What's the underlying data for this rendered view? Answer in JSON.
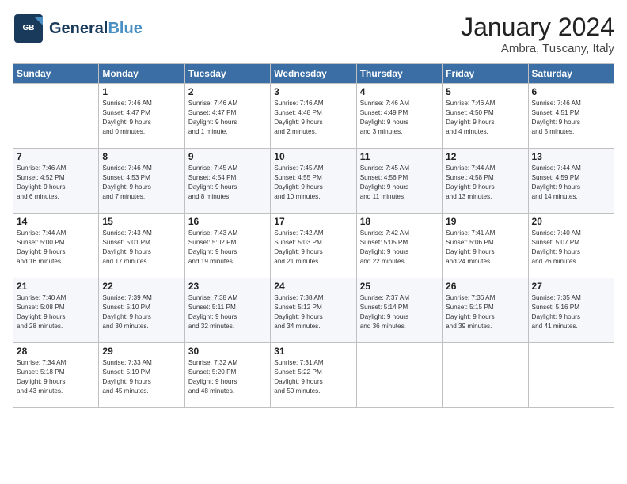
{
  "header": {
    "logo_line1": "General",
    "logo_line2": "Blue",
    "title": "January 2024",
    "subtitle": "Ambra, Tuscany, Italy"
  },
  "columns": [
    "Sunday",
    "Monday",
    "Tuesday",
    "Wednesday",
    "Thursday",
    "Friday",
    "Saturday"
  ],
  "weeks": [
    [
      {
        "day": "",
        "sunrise": "",
        "sunset": "",
        "daylight": ""
      },
      {
        "day": "1",
        "sunrise": "Sunrise: 7:46 AM",
        "sunset": "Sunset: 4:47 PM",
        "daylight": "Daylight: 9 hours and 0 minutes."
      },
      {
        "day": "2",
        "sunrise": "Sunrise: 7:46 AM",
        "sunset": "Sunset: 4:47 PM",
        "daylight": "Daylight: 9 hours and 1 minute."
      },
      {
        "day": "3",
        "sunrise": "Sunrise: 7:46 AM",
        "sunset": "Sunset: 4:48 PM",
        "daylight": "Daylight: 9 hours and 2 minutes."
      },
      {
        "day": "4",
        "sunrise": "Sunrise: 7:46 AM",
        "sunset": "Sunset: 4:49 PM",
        "daylight": "Daylight: 9 hours and 3 minutes."
      },
      {
        "day": "5",
        "sunrise": "Sunrise: 7:46 AM",
        "sunset": "Sunset: 4:50 PM",
        "daylight": "Daylight: 9 hours and 4 minutes."
      },
      {
        "day": "6",
        "sunrise": "Sunrise: 7:46 AM",
        "sunset": "Sunset: 4:51 PM",
        "daylight": "Daylight: 9 hours and 5 minutes."
      }
    ],
    [
      {
        "day": "7",
        "sunrise": "Sunrise: 7:46 AM",
        "sunset": "Sunset: 4:52 PM",
        "daylight": "Daylight: 9 hours and 6 minutes."
      },
      {
        "day": "8",
        "sunrise": "Sunrise: 7:46 AM",
        "sunset": "Sunset: 4:53 PM",
        "daylight": "Daylight: 9 hours and 7 minutes."
      },
      {
        "day": "9",
        "sunrise": "Sunrise: 7:45 AM",
        "sunset": "Sunset: 4:54 PM",
        "daylight": "Daylight: 9 hours and 8 minutes."
      },
      {
        "day": "10",
        "sunrise": "Sunrise: 7:45 AM",
        "sunset": "Sunset: 4:55 PM",
        "daylight": "Daylight: 9 hours and 10 minutes."
      },
      {
        "day": "11",
        "sunrise": "Sunrise: 7:45 AM",
        "sunset": "Sunset: 4:56 PM",
        "daylight": "Daylight: 9 hours and 11 minutes."
      },
      {
        "day": "12",
        "sunrise": "Sunrise: 7:44 AM",
        "sunset": "Sunset: 4:58 PM",
        "daylight": "Daylight: 9 hours and 13 minutes."
      },
      {
        "day": "13",
        "sunrise": "Sunrise: 7:44 AM",
        "sunset": "Sunset: 4:59 PM",
        "daylight": "Daylight: 9 hours and 14 minutes."
      }
    ],
    [
      {
        "day": "14",
        "sunrise": "Sunrise: 7:44 AM",
        "sunset": "Sunset: 5:00 PM",
        "daylight": "Daylight: 9 hours and 16 minutes."
      },
      {
        "day": "15",
        "sunrise": "Sunrise: 7:43 AM",
        "sunset": "Sunset: 5:01 PM",
        "daylight": "Daylight: 9 hours and 17 minutes."
      },
      {
        "day": "16",
        "sunrise": "Sunrise: 7:43 AM",
        "sunset": "Sunset: 5:02 PM",
        "daylight": "Daylight: 9 hours and 19 minutes."
      },
      {
        "day": "17",
        "sunrise": "Sunrise: 7:42 AM",
        "sunset": "Sunset: 5:03 PM",
        "daylight": "Daylight: 9 hours and 21 minutes."
      },
      {
        "day": "18",
        "sunrise": "Sunrise: 7:42 AM",
        "sunset": "Sunset: 5:05 PM",
        "daylight": "Daylight: 9 hours and 22 minutes."
      },
      {
        "day": "19",
        "sunrise": "Sunrise: 7:41 AM",
        "sunset": "Sunset: 5:06 PM",
        "daylight": "Daylight: 9 hours and 24 minutes."
      },
      {
        "day": "20",
        "sunrise": "Sunrise: 7:40 AM",
        "sunset": "Sunset: 5:07 PM",
        "daylight": "Daylight: 9 hours and 26 minutes."
      }
    ],
    [
      {
        "day": "21",
        "sunrise": "Sunrise: 7:40 AM",
        "sunset": "Sunset: 5:08 PM",
        "daylight": "Daylight: 9 hours and 28 minutes."
      },
      {
        "day": "22",
        "sunrise": "Sunrise: 7:39 AM",
        "sunset": "Sunset: 5:10 PM",
        "daylight": "Daylight: 9 hours and 30 minutes."
      },
      {
        "day": "23",
        "sunrise": "Sunrise: 7:38 AM",
        "sunset": "Sunset: 5:11 PM",
        "daylight": "Daylight: 9 hours and 32 minutes."
      },
      {
        "day": "24",
        "sunrise": "Sunrise: 7:38 AM",
        "sunset": "Sunset: 5:12 PM",
        "daylight": "Daylight: 9 hours and 34 minutes."
      },
      {
        "day": "25",
        "sunrise": "Sunrise: 7:37 AM",
        "sunset": "Sunset: 5:14 PM",
        "daylight": "Daylight: 9 hours and 36 minutes."
      },
      {
        "day": "26",
        "sunrise": "Sunrise: 7:36 AM",
        "sunset": "Sunset: 5:15 PM",
        "daylight": "Daylight: 9 hours and 39 minutes."
      },
      {
        "day": "27",
        "sunrise": "Sunrise: 7:35 AM",
        "sunset": "Sunset: 5:16 PM",
        "daylight": "Daylight: 9 hours and 41 minutes."
      }
    ],
    [
      {
        "day": "28",
        "sunrise": "Sunrise: 7:34 AM",
        "sunset": "Sunset: 5:18 PM",
        "daylight": "Daylight: 9 hours and 43 minutes."
      },
      {
        "day": "29",
        "sunrise": "Sunrise: 7:33 AM",
        "sunset": "Sunset: 5:19 PM",
        "daylight": "Daylight: 9 hours and 45 minutes."
      },
      {
        "day": "30",
        "sunrise": "Sunrise: 7:32 AM",
        "sunset": "Sunset: 5:20 PM",
        "daylight": "Daylight: 9 hours and 48 minutes."
      },
      {
        "day": "31",
        "sunrise": "Sunrise: 7:31 AM",
        "sunset": "Sunset: 5:22 PM",
        "daylight": "Daylight: 9 hours and 50 minutes."
      },
      {
        "day": "",
        "sunrise": "",
        "sunset": "",
        "daylight": ""
      },
      {
        "day": "",
        "sunrise": "",
        "sunset": "",
        "daylight": ""
      },
      {
        "day": "",
        "sunrise": "",
        "sunset": "",
        "daylight": ""
      }
    ]
  ]
}
